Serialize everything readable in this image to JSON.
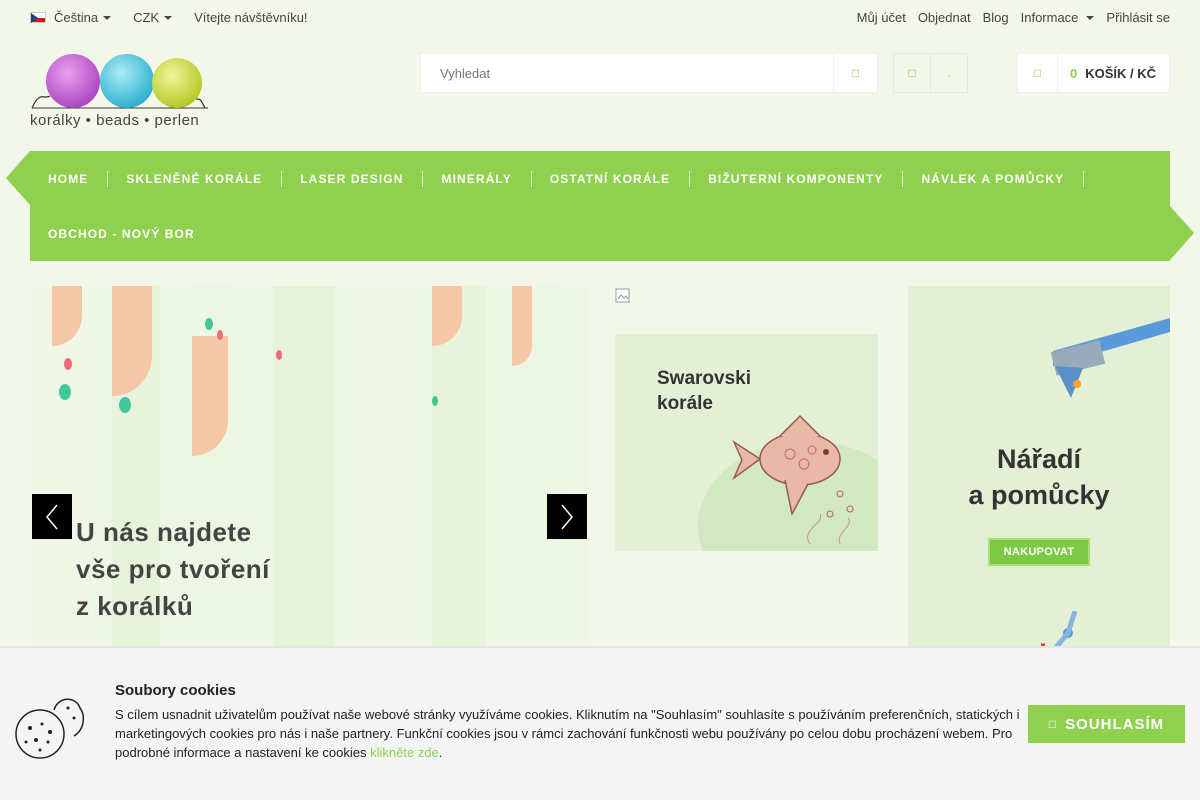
{
  "topbar": {
    "language": "Čeština",
    "currency": "CZK",
    "welcome": "Vítejte návštěvníku!",
    "links": [
      "Můj účet",
      "Objednat",
      "Blog",
      "Informace",
      "Přihlásit se"
    ]
  },
  "logo": {
    "text": "korálky • beads • perlen"
  },
  "search": {
    "placeholder": "Vyhledat",
    "button_icon": "search-icon"
  },
  "header_icons": [
    "heart-icon",
    "compare-icon"
  ],
  "cart": {
    "icon": "cart-icon",
    "count": "0",
    "label": "KOŠÍK / KČ"
  },
  "nav": {
    "items": [
      "HOME",
      "SKLENĚNÉ KORÁLE",
      "LASER DESIGN",
      "MINERÁLY",
      "OSTATNÍ KORÁLE",
      "BIŽUTERNÍ KOMPONENTY",
      "NÁVLEK A POMŮCKY",
      "OBCHOD - NOVÝ BOR"
    ]
  },
  "slider": {
    "text_lines": [
      "U nás najdete",
      "vše pro tvoření",
      "z korálků"
    ]
  },
  "banners": {
    "swarovski_title": [
      "Swarovski",
      "korále"
    ],
    "tools_title": [
      "Nářadí",
      "a pomůcky"
    ],
    "tools_button": "NAKUPOVAT"
  },
  "cookie": {
    "title": "Soubory cookies",
    "text": "S cílem usnadnit uživatelům používat naše webové stránky využíváme cookies. Kliknutím na \"Souhlasím\" souhlasíte s používáním preferenčních, statických i marketingových cookies pro nás i naše partnery. Funkční cookies jsou v rámci zachování funkčnosti webu používány po celou dobu procházení webem. Pro podrobné informace a nastavení ke cookies ",
    "link": "klikněte zde",
    "text_end": ".",
    "button": "SOUHLASÍM"
  },
  "colors": {
    "accent": "#8fd14f",
    "background": "#f3f7ea",
    "cookie_bg": "#f4f4f4"
  }
}
